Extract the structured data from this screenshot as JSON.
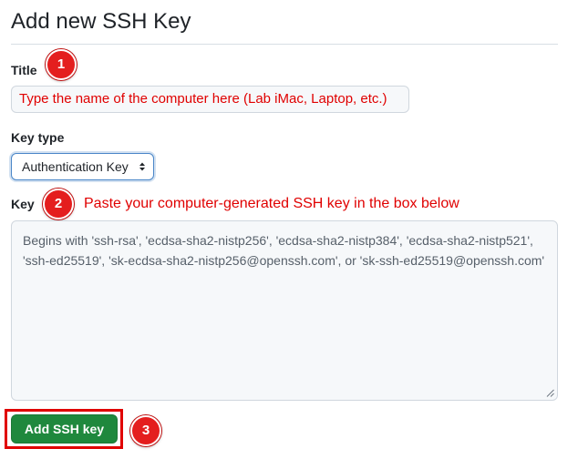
{
  "page": {
    "title": "Add new SSH Key"
  },
  "form": {
    "title_label": "Title",
    "title_value": "Type the name of the computer here (Lab iMac, Laptop, etc.)",
    "key_type_label": "Key type",
    "key_type_selected": "Authentication Key",
    "key_label": "Key",
    "key_hint": "Paste your computer-generated SSH key in the box below",
    "key_placeholder": "Begins with 'ssh-rsa', 'ecdsa-sha2-nistp256', 'ecdsa-sha2-nistp384', 'ecdsa-sha2-nistp521', 'ssh-ed25519', 'sk-ecdsa-sha2-nistp256@openssh.com', or 'sk-ssh-ed25519@openssh.com'",
    "submit_label": "Add SSH key"
  },
  "annotations": {
    "step1": "1",
    "step2": "2",
    "step3": "3"
  },
  "colors": {
    "annotation_red": "#e00000",
    "primary_green": "#1f883d",
    "focus_blue": "#4a86c8"
  },
  "icons": {
    "select_arrows": "select-arrows-icon",
    "resize_handle": "resize-handle-icon"
  }
}
